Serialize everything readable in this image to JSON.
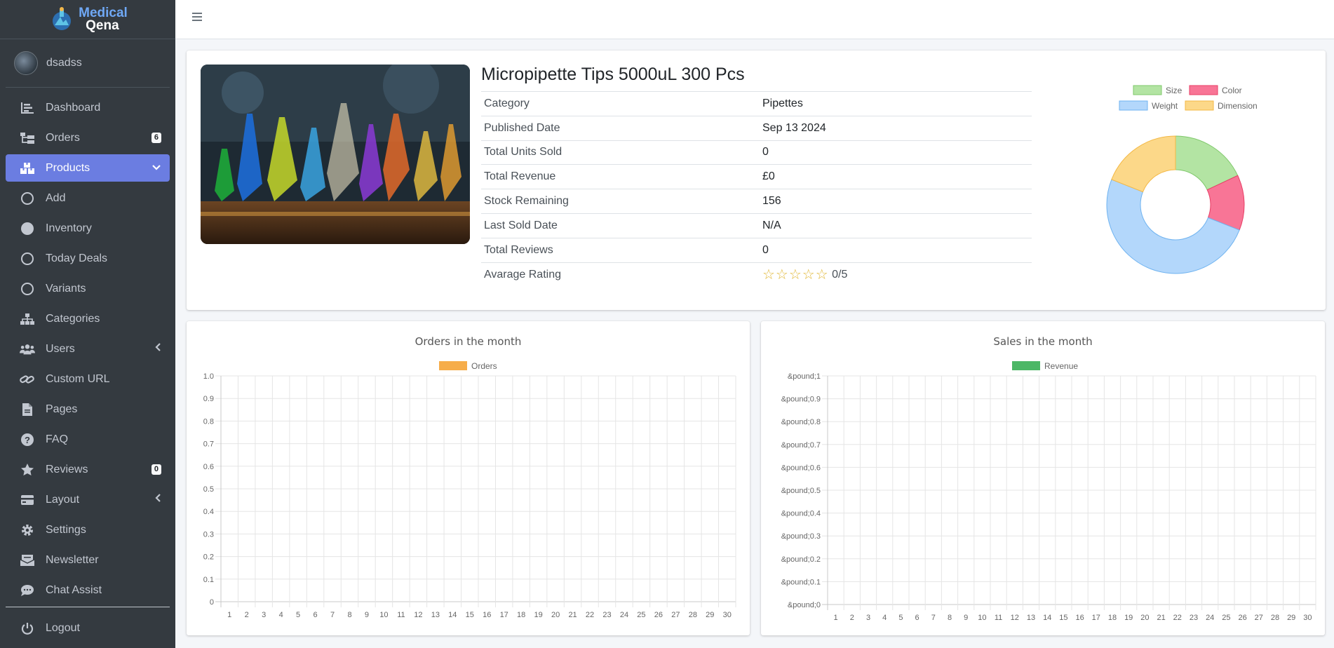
{
  "brand": {
    "line1": "Medical",
    "line2": "Qena"
  },
  "user": {
    "name": "dsadss"
  },
  "sidebar": {
    "items": [
      {
        "label": "Dashboard",
        "icon": "chart-icon"
      },
      {
        "label": "Orders",
        "icon": "orders-icon",
        "badge": "6"
      },
      {
        "label": "Products",
        "icon": "boxes-icon",
        "active": true
      },
      {
        "label": "Add",
        "icon": "circle-outline-icon"
      },
      {
        "label": "Inventory",
        "icon": "circle-filled-icon"
      },
      {
        "label": "Today Deals",
        "icon": "circle-outline-icon"
      },
      {
        "label": "Variants",
        "icon": "circle-outline-icon"
      },
      {
        "label": "Categories",
        "icon": "sitemap-icon"
      },
      {
        "label": "Users",
        "icon": "users-icon"
      },
      {
        "label": "Custom URL",
        "icon": "link-icon"
      },
      {
        "label": "Pages",
        "icon": "file-icon"
      },
      {
        "label": "FAQ",
        "icon": "question-icon"
      },
      {
        "label": "Reviews",
        "icon": "star-icon",
        "badge": "0"
      },
      {
        "label": "Layout",
        "icon": "layout-icon"
      },
      {
        "label": "Settings",
        "icon": "gear-icon"
      },
      {
        "label": "Newsletter",
        "icon": "newsletter-icon"
      },
      {
        "label": "Chat Assist",
        "icon": "chat-icon"
      }
    ],
    "logout": "Logout"
  },
  "product": {
    "title": "Micropipette Tips 5000uL 300 Pcs",
    "rows": [
      {
        "label": "Category",
        "value": "Pipettes"
      },
      {
        "label": "Published Date",
        "value": "Sep 13 2024"
      },
      {
        "label": "Total Units Sold",
        "value": "0"
      },
      {
        "label": "Total Revenue",
        "value": "£0"
      },
      {
        "label": "Stock Remaining",
        "value": "156"
      },
      {
        "label": "Last Sold Date",
        "value": "N/A"
      },
      {
        "label": "Total Reviews",
        "value": "0"
      },
      {
        "label": "Avarage Rating",
        "value": "0/5"
      }
    ],
    "stars": "☆☆☆☆☆"
  },
  "colors": {
    "accent": "#6b7de1",
    "sidebar": "#343a40",
    "stock": "#28a745",
    "star": "#e2b93b"
  },
  "chart_data": [
    {
      "type": "pie",
      "title": "",
      "legend_position": "top",
      "labels": [
        "Size",
        "Color",
        "Weight",
        "Dimension"
      ],
      "values": [
        18,
        13,
        50,
        19
      ],
      "colors": [
        "#b3e4a3",
        "#f87596",
        "#b3d7fb",
        "#fcd889"
      ],
      "borders": [
        "#7fc86b",
        "#e83e65",
        "#6fb3f0",
        "#f3b845"
      ]
    },
    {
      "type": "bar",
      "title": "Orders in the month",
      "series": [
        {
          "name": "Orders",
          "color": "#f6ad4a",
          "values": []
        }
      ],
      "categories": [
        "1",
        "2",
        "3",
        "4",
        "5",
        "6",
        "7",
        "8",
        "9",
        "10",
        "11",
        "12",
        "13",
        "14",
        "15",
        "16",
        "17",
        "18",
        "19",
        "20",
        "21",
        "22",
        "23",
        "24",
        "25",
        "26",
        "27",
        "28",
        "29",
        "30"
      ],
      "y_ticks": [
        "1.0",
        "0.9",
        "0.8",
        "0.7",
        "0.6",
        "0.5",
        "0.4",
        "0.3",
        "0.2",
        "0.1",
        "0"
      ],
      "ylim": [
        0,
        1
      ],
      "grid": true
    },
    {
      "type": "bar",
      "title": "Sales in the month",
      "series": [
        {
          "name": "Revenue",
          "color": "#4cb766",
          "values": []
        }
      ],
      "categories": [
        "1",
        "2",
        "3",
        "4",
        "5",
        "6",
        "7",
        "8",
        "9",
        "10",
        "11",
        "12",
        "13",
        "14",
        "15",
        "16",
        "17",
        "18",
        "19",
        "20",
        "21",
        "22",
        "23",
        "24",
        "25",
        "26",
        "27",
        "28",
        "29",
        "30"
      ],
      "y_ticks": [
        "&pound;1",
        "&pound;0.9",
        "&pound;0.8",
        "&pound;0.7",
        "&pound;0.6",
        "&pound;0.5",
        "&pound;0.4",
        "&pound;0.3",
        "&pound;0.2",
        "&pound;0.1",
        "&pound;0"
      ],
      "ylim": [
        0,
        1
      ],
      "grid": true
    }
  ]
}
